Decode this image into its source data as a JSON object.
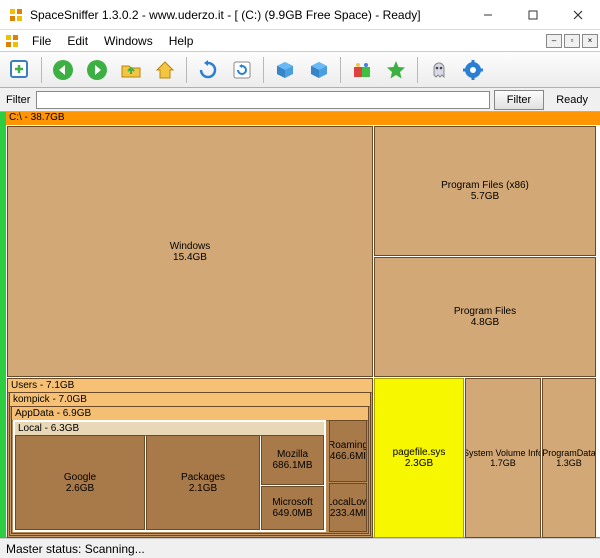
{
  "window": {
    "title": "SpaceSniffer 1.3.0.2 - www.uderzo.it - [ (C:) (9.9GB Free Space) - Ready]"
  },
  "menu": {
    "file": "File",
    "edit": "Edit",
    "windows": "Windows",
    "help": "Help"
  },
  "filter": {
    "label": "Filter",
    "button": "Filter",
    "ready": "Ready",
    "value": ""
  },
  "treemap": {
    "root": "C:\\ - 38.7GB",
    "windows": {
      "name": "Windows",
      "size": "15.4GB"
    },
    "pf86": {
      "name": "Program Files (x86)",
      "size": "5.7GB"
    },
    "pf": {
      "name": "Program Files",
      "size": "4.8GB"
    },
    "users_hdr": "Users - 7.1GB",
    "kompick_hdr": "kompick - 7.0GB",
    "appdata_hdr": "AppData - 6.9GB",
    "local_hdr": "Local - 6.3GB",
    "google": {
      "name": "Google",
      "size": "2.6GB"
    },
    "packages": {
      "name": "Packages",
      "size": "2.1GB"
    },
    "mozilla": {
      "name": "Mozilla",
      "size": "686.1MB"
    },
    "microsoft": {
      "name": "Microsoft",
      "size": "649.0MB"
    },
    "roaming": {
      "name": "Roaming",
      "size": "466.6MI"
    },
    "locallow": {
      "name": "LocalLow",
      "size": "233.4MI"
    },
    "pagefile": {
      "name": "pagefile.sys",
      "size": "2.3GB"
    },
    "svi": {
      "name": "System Volume Info",
      "size": "1.7GB"
    },
    "programdata": {
      "name": "ProgramData",
      "size": "1.3GB"
    }
  },
  "status": "Master status: Scanning..."
}
